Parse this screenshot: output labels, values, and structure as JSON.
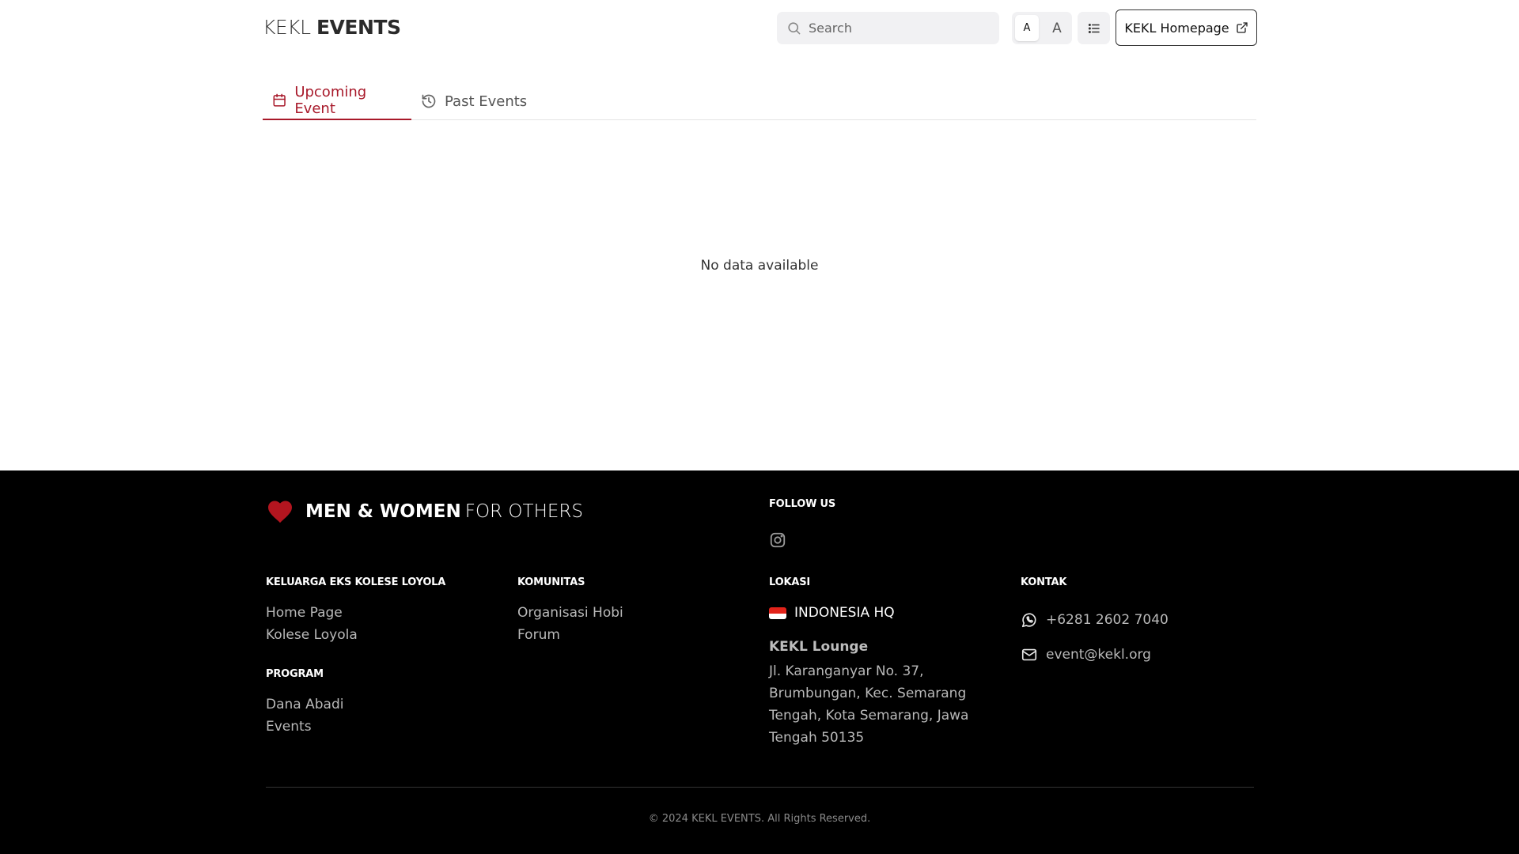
{
  "header": {
    "logo_light": "KEKL",
    "logo_bold": "EVENTS",
    "search_placeholder": "Search",
    "font_small_label": "A",
    "font_large_label": "A",
    "homepage_button": "KEKL Homepage"
  },
  "tabs": [
    {
      "label": "Upcoming Event",
      "active": true,
      "icon": "calendar-icon"
    },
    {
      "label": "Past Events",
      "active": false,
      "icon": "history-icon"
    }
  ],
  "main": {
    "empty_message": "No data available"
  },
  "footer": {
    "brand_strong": "MEN & WOMEN",
    "brand_weak": "FOR OTHERS",
    "follow_us": "FOLLOW US",
    "sections": {
      "kekl": {
        "title": "KELUARGA EKS KOLESE LOYOLA",
        "links": [
          "Home Page",
          "Kolese Loyola"
        ]
      },
      "program": {
        "title": "PROGRAM",
        "links": [
          "Dana Abadi",
          "Events"
        ]
      },
      "komunitas": {
        "title": "KOMUNITAS",
        "links": [
          "Organisasi Hobi",
          "Forum"
        ]
      },
      "lokasi": {
        "title": "LOKASI",
        "hq_label": "INDONESIA HQ",
        "venue": "KEKL Lounge",
        "address": "Jl. Karanganyar No. 37, Brumbungan, Kec. Semarang Tengah, Kota Semarang, Jawa Tengah 50135"
      },
      "kontak": {
        "title": "KONTAK",
        "phone": "+6281 2602 7040",
        "email": "event@kekl.org"
      }
    },
    "copyright": "© 2024 KEKL EVENTS. All Rights Reserved."
  },
  "colors": {
    "accent": "#a8192a",
    "footer_bg": "#000000",
    "heart": "#b3151f"
  }
}
